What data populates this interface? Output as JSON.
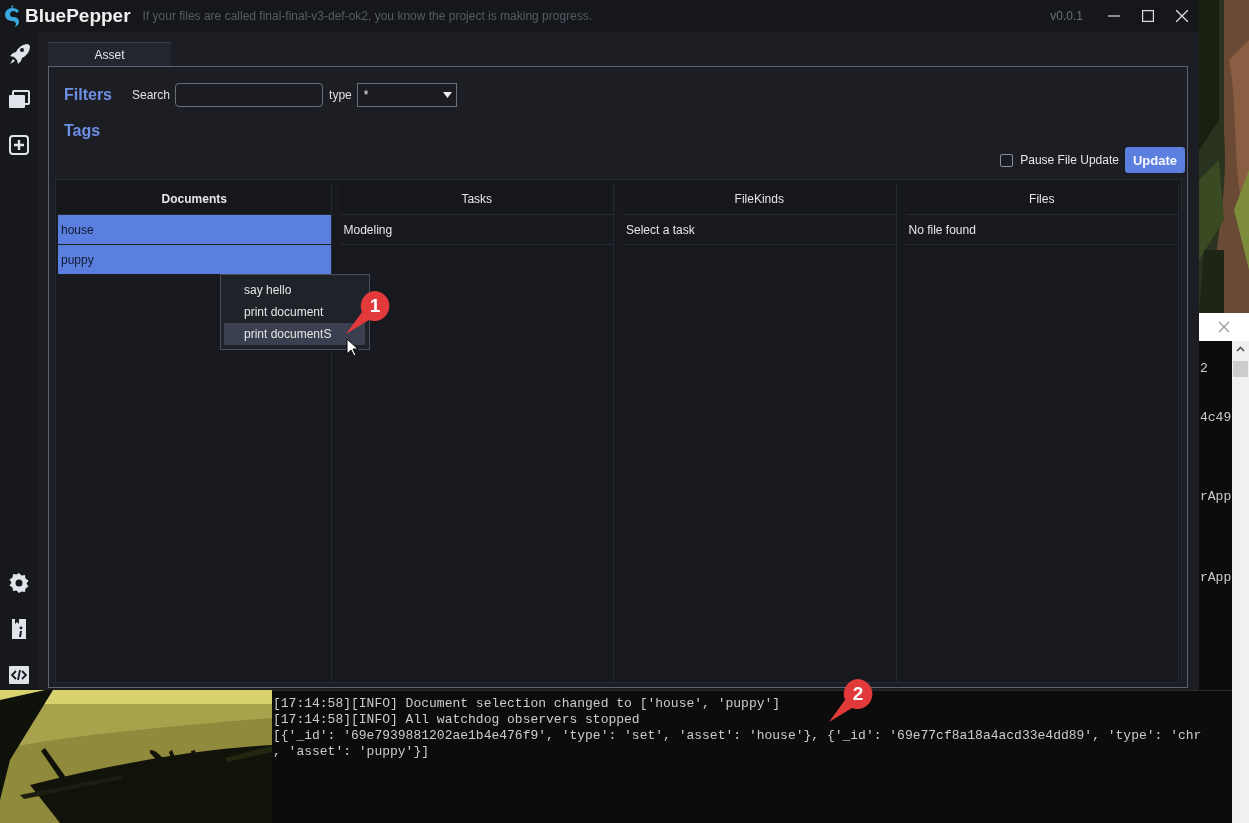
{
  "window": {
    "title": "BluePepper",
    "subtitle": "If your files are called final-final-v3-def-ok2, you know the project is making progress.",
    "version": "v0.0.1"
  },
  "tabs": [
    {
      "label": "Asset",
      "selected": true
    }
  ],
  "filters": {
    "title": "Filters",
    "search_label": "Search",
    "type_label": "type",
    "type_value": "*"
  },
  "tags": {
    "title": "Tags"
  },
  "pause_file_update": {
    "label": "Pause File Update",
    "checked": false
  },
  "update_button": "Update",
  "columns": [
    {
      "title": "Documents",
      "focused": true,
      "items": [
        {
          "label": "house",
          "selected": true
        },
        {
          "label": "puppy",
          "selected": true
        }
      ]
    },
    {
      "title": "Tasks",
      "focused": false,
      "items": [
        {
          "label": "Modeling",
          "selected": false
        }
      ]
    },
    {
      "title": "FileKinds",
      "focused": false,
      "message": "Select a task"
    },
    {
      "title": "Files",
      "focused": false,
      "message": "No file found"
    }
  ],
  "context_menu": {
    "items": [
      {
        "label": "say hello",
        "selected": false
      },
      {
        "label": "print document",
        "selected": false
      },
      {
        "label": "print documentS",
        "selected": true
      }
    ]
  },
  "callouts": [
    {
      "number": "1"
    },
    {
      "number": "2"
    }
  ],
  "console": {
    "lines": [
      "[17:14:58][INFO] Document selection changed to ['house', 'puppy']",
      "[17:14:58][INFO] All watchdog observers stopped",
      "[{'_id': '69e7939881202ae1b4e476f9', 'type': 'set', 'asset': 'house'}, {'_id': '69e77cf8a18a4acd33e4dd89', 'type': 'chr",
      ", 'asset': 'puppy'}]"
    ]
  },
  "background_window": {
    "lines": [
      "2",
      "4c49",
      "rApp",
      "rApp"
    ]
  }
}
